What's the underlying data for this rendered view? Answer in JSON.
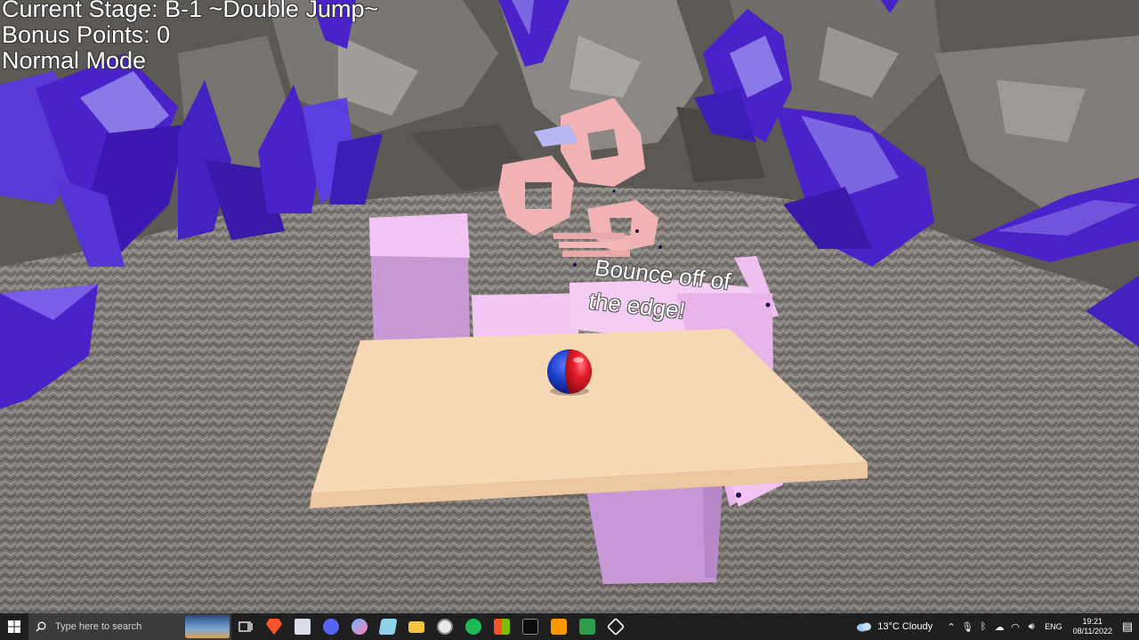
{
  "hud": {
    "stage": "Current Stage: B-1 ~Double Jump~",
    "bonus": "Bonus Points: 0",
    "mode": "Normal Mode"
  },
  "sign": {
    "line1": "Bounce off of",
    "line2": "the edge!"
  },
  "colors": {
    "crystal": "#4a22c9",
    "crystal_light": "#7b66e0",
    "platform_main": "#f5d9b4",
    "platform_pink": "#f0c2f0",
    "gear": "#f0b2b2",
    "ball_red": "#e81c2c",
    "ball_blue": "#1c3cc8",
    "floor": "#6e6a66"
  },
  "taskbar": {
    "search_placeholder": "Type here to search",
    "icons": [
      "start-icon",
      "task-view-icon",
      "brave-icon",
      "files-icon",
      "discord-icon",
      "paint-icon",
      "notepad-icon",
      "folder-icon",
      "clock-app-icon",
      "spotify-icon",
      "store-icon",
      "terminal-icon",
      "sublime-icon",
      "greenshot-icon",
      "unity-icon"
    ],
    "weather": "13°C  Cloudy",
    "language": "ENG",
    "time": "19:21",
    "date": "08/11/2022"
  }
}
